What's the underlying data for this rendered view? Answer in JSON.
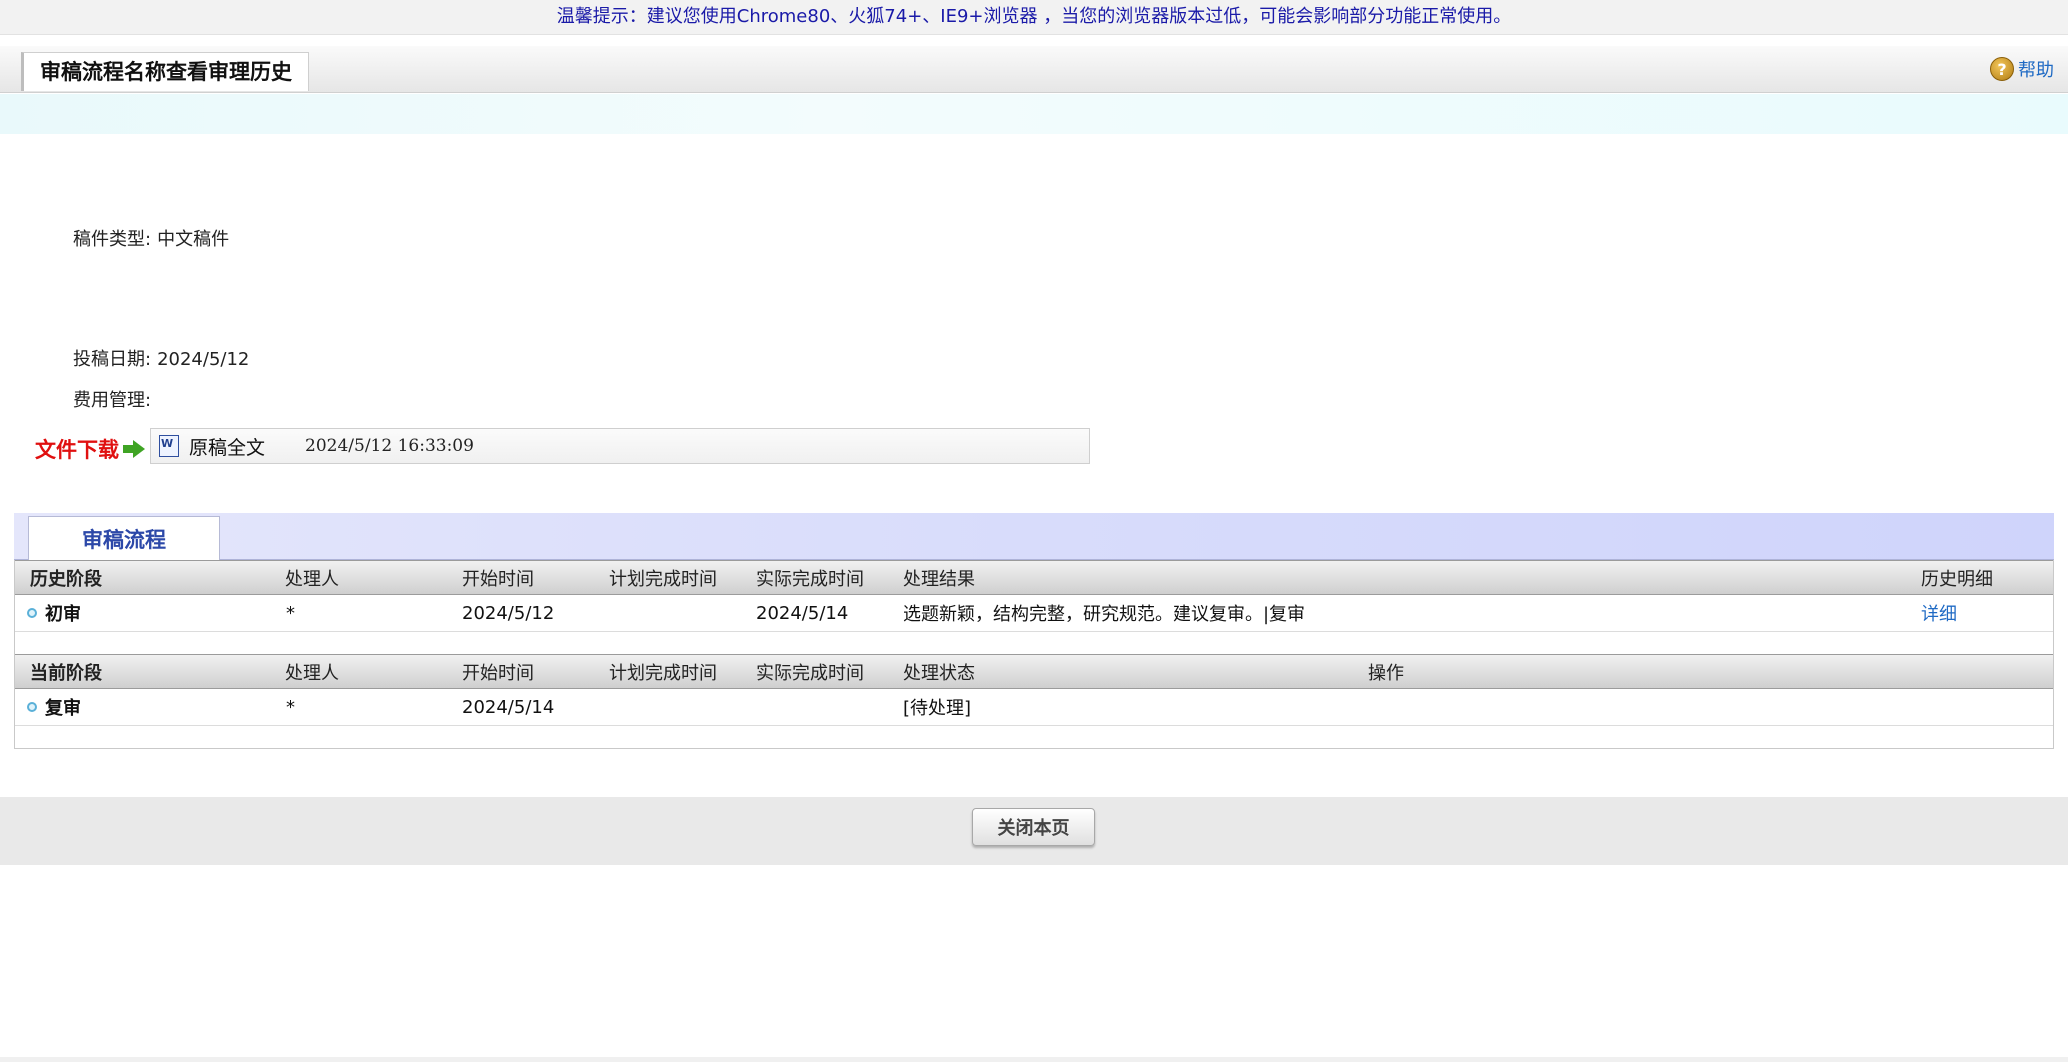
{
  "notice": "温馨提示：建议您使用Chrome80、火狐74+、IE9+浏览器 ，当您的浏览器版本过低，可能会影响部分功能正常使用。",
  "header": {
    "title": "审稿流程名称查看审理历史",
    "help_label": "帮助"
  },
  "fields": {
    "manuscript_type_label": "稿件类型:",
    "manuscript_type_value": "中文稿件",
    "submit_date_label": "投稿日期:",
    "submit_date_value": "2024/5/12",
    "fee_label": "费用管理:",
    "fee_value": ""
  },
  "download": {
    "label": "文件下载",
    "file_name": "原稿全文",
    "file_time": "2024/5/12 16:33:09"
  },
  "process": {
    "tab_label": "审稿流程",
    "history_headers": [
      "历史阶段",
      "处理人",
      "开始时间",
      "计划完成时间",
      "实际完成时间",
      "处理结果",
      "历史明细"
    ],
    "history_rows": [
      {
        "stage": "初审",
        "handler": "*",
        "start": "2024/5/12",
        "planned": "",
        "actual": "2024/5/14",
        "result": "选题新颖，结构完整，研究规范。建议复审。|复审",
        "detail_link": "详细"
      }
    ],
    "current_headers": [
      "当前阶段",
      "处理人",
      "开始时间",
      "计划完成时间",
      "实际完成时间",
      "处理状态",
      "操作"
    ],
    "current_rows": [
      {
        "stage": "复审",
        "handler": "*",
        "start": "2024/5/14",
        "planned": "",
        "actual": "",
        "status": "[待处理]",
        "operation": ""
      }
    ]
  },
  "footer": {
    "close_label": "关闭本页"
  }
}
